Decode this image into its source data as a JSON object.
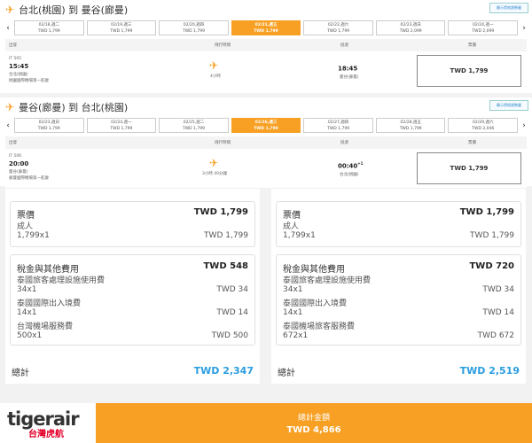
{
  "outbound": {
    "title": "台北(桃園) 到 曼谷(廊曼)",
    "trend_label": "顯示價格趨勢圖",
    "dates": [
      {
        "d": "02/18,週二",
        "p": "TWD 1,799"
      },
      {
        "d": "02/19,週三",
        "p": "TWD 1,799"
      },
      {
        "d": "02/20,週四",
        "p": "TWD 1,799"
      },
      {
        "d": "02/21,週五",
        "p": "TWD 1,799"
      },
      {
        "d": "02/22,週六",
        "p": "TWD 1,799"
      },
      {
        "d": "02/23,週日",
        "p": "TWD 2,099"
      },
      {
        "d": "02/24,週一",
        "p": "TWD 2,099"
      }
    ],
    "cols": {
      "dep": "出發",
      "dur": "飛行時間",
      "arr": "抵達",
      "fare": "票價"
    },
    "flight": {
      "no": "IT 505",
      "dep_time": "15:45",
      "dep_city": "台北(桃園)",
      "dep_airport": "桃園國際機場第一航廈",
      "duration": "4小時",
      "arr_time": "18:45",
      "arr_city": "曼谷(廊曼)",
      "price": "TWD 1,799"
    }
  },
  "inbound": {
    "title": "曼谷(廊曼) 到 台北(桃園)",
    "trend_label": "顯示價格趨勢圖",
    "dates": [
      {
        "d": "02/23,週日",
        "p": "TWD 1,799"
      },
      {
        "d": "02/24,週一",
        "p": "TWD 1,799"
      },
      {
        "d": "02/25,週二",
        "p": "TWD 1,799"
      },
      {
        "d": "02/26,週三",
        "p": "TWD 1,799"
      },
      {
        "d": "02/27,週四",
        "p": "TWD 1,799"
      },
      {
        "d": "02/28,週五",
        "p": "TWD 1,799"
      },
      {
        "d": "02/29,週六",
        "p": "TWD 2,046"
      }
    ],
    "cols": {
      "dep": "出發",
      "dur": "飛行時間",
      "arr": "抵達",
      "fare": "票價"
    },
    "flight": {
      "no": "IT 506",
      "dep_time": "20:00",
      "dep_city": "曼谷(廊曼)",
      "dep_airport": "廊曼國際機場第一航廈",
      "duration": "3小時 40分鐘",
      "arr_time": "00:40",
      "arr_plus": "+1",
      "arr_city": "台北(桃園)",
      "price": "TWD 1,799"
    }
  },
  "breakdown": [
    {
      "fare_label": "票價",
      "fare_total": "TWD 1,799",
      "adult": "成人",
      "adult_qty": "1,799x1",
      "adult_amt": "TWD 1,799",
      "tax_label": "稅金與其他費用",
      "tax_total": "TWD 548",
      "items": [
        {
          "n": "泰國旅客處理設施使用費",
          "q": "34x1",
          "a": "TWD 34"
        },
        {
          "n": "泰國國際出入境費",
          "q": "14x1",
          "a": "TWD 14"
        },
        {
          "n": "台灣機場服務費",
          "q": "500x1",
          "a": "TWD 500"
        }
      ],
      "total_label": "總計",
      "total": "TWD 2,347"
    },
    {
      "fare_label": "票價",
      "fare_total": "TWD 1,799",
      "adult": "成人",
      "adult_qty": "1,799x1",
      "adult_amt": "TWD 1,799",
      "tax_label": "稅金與其他費用",
      "tax_total": "TWD 720",
      "items": [
        {
          "n": "泰國旅客處理設施使用費",
          "q": "34x1",
          "a": "TWD 34"
        },
        {
          "n": "泰國國際出入境費",
          "q": "14x1",
          "a": "TWD 14"
        },
        {
          "n": "泰國機場旅客服務費",
          "q": "672x1",
          "a": "TWD 672"
        }
      ],
      "total_label": "總計",
      "total": "TWD 2,519"
    }
  ],
  "footer": {
    "logo": "tigerair",
    "logo_sub": "台灣虎航",
    "total_label": "總計金額",
    "total": "TWD 4,866"
  }
}
